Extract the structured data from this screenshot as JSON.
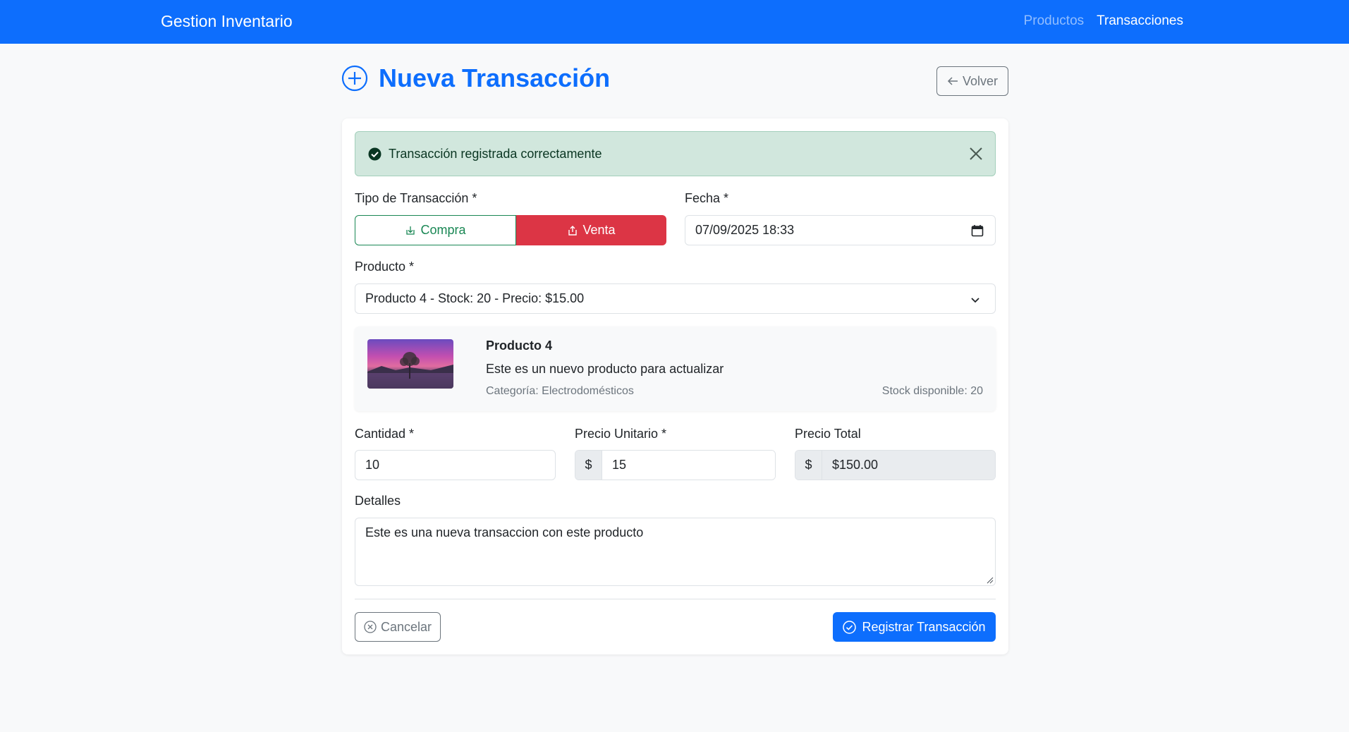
{
  "navbar": {
    "brand": "Gestion Inventario",
    "links": [
      {
        "label": "Productos",
        "active": false
      },
      {
        "label": "Transacciones",
        "active": true
      }
    ]
  },
  "page": {
    "title": "Nueva Transacción",
    "back_label": "Volver",
    "title_icon": "plus-circle-icon"
  },
  "alert": {
    "message": "Transacción registrada correctamente",
    "type": "success"
  },
  "form": {
    "tipo_label": "Tipo de Transacción *",
    "compra_label": "Compra",
    "venta_label": "Venta",
    "selected_tipo": "Venta",
    "fecha_label": "Fecha *",
    "fecha_value": "07/09/2025 18:33",
    "producto_label": "Producto *",
    "producto_value": "Producto 4 - Stock: 20 - Precio: $15.00",
    "cantidad_label": "Cantidad *",
    "cantidad_value": "10",
    "precio_unitario_label": "Precio Unitario *",
    "precio_unitario_value": "15",
    "precio_total_label": "Precio Total",
    "precio_total_value": "$150.00",
    "currency_symbol": "$",
    "detalles_label": "Detalles",
    "detalles_value": "Este es una nueva transaccion con este producto",
    "cancel_label": "Cancelar",
    "submit_label": "Registrar Transacción"
  },
  "product_preview": {
    "name": "Producto 4",
    "description": "Este es un nuevo producto para actualizar",
    "category": "Categoría: Electrodomésticos",
    "stock": "Stock disponible: 20"
  },
  "colors": {
    "primary": "#0d6efd",
    "success": "#198754",
    "danger": "#dc3545",
    "secondary": "#6c757d"
  }
}
